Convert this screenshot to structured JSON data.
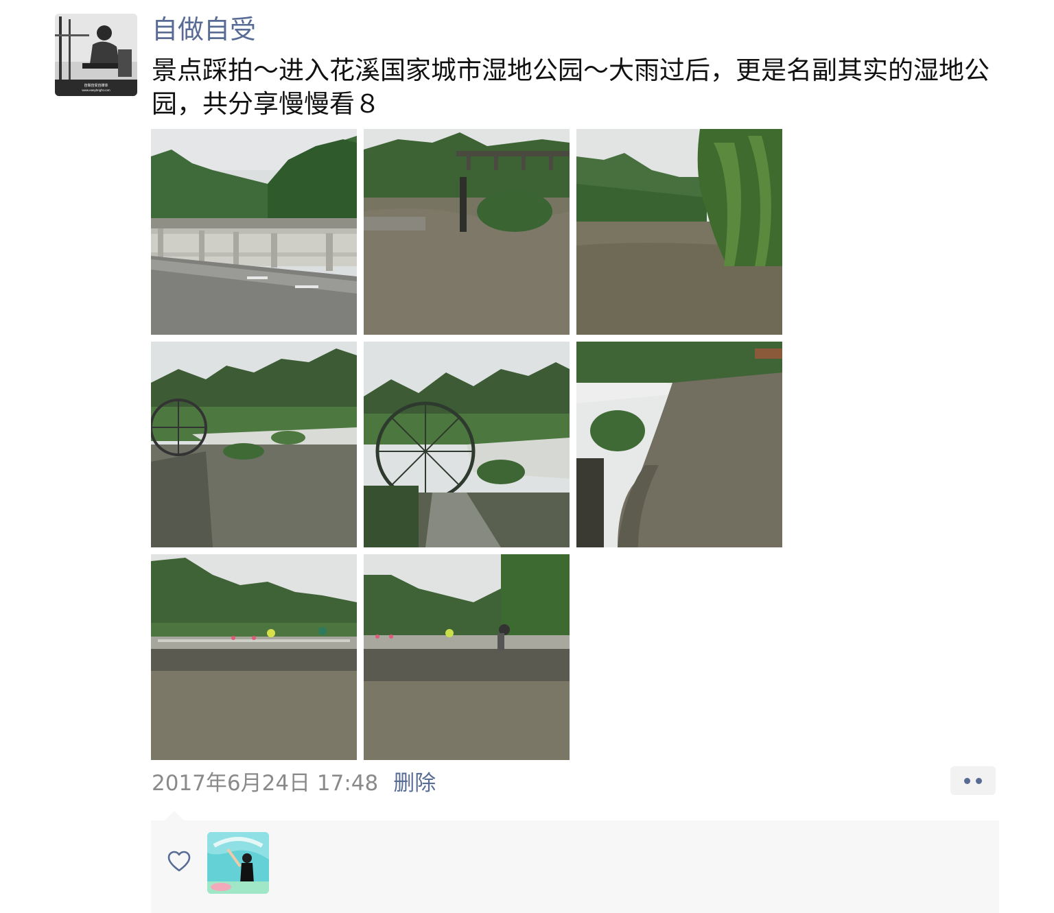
{
  "post": {
    "author": "自做自受",
    "text": "景点踩拍～进入花溪国家城市湿地公园～大雨过后，更是名副其实的湿地公园，共分享慢慢看８",
    "timestamp": "2017年6月24日 17:48",
    "delete_label": "删除"
  },
  "avatar_watermark": "自做自受自媒体 www.easybright.com",
  "photos": [
    {
      "name": "bridge-railing-river"
    },
    {
      "name": "river-bridge-gauge"
    },
    {
      "name": "river-willow"
    },
    {
      "name": "rapids-waterwheel-left"
    },
    {
      "name": "waterwheel-path"
    },
    {
      "name": "weir-waterfall"
    },
    {
      "name": "stone-bridge-crowd-1"
    },
    {
      "name": "stone-bridge-crowd-2"
    }
  ],
  "icons": {
    "more": "more-dots-icon",
    "like": "heart-icon"
  },
  "colors": {
    "link": "#576b95",
    "text": "#111111",
    "meta": "#8a8a8a",
    "panel": "#f7f7f7"
  }
}
